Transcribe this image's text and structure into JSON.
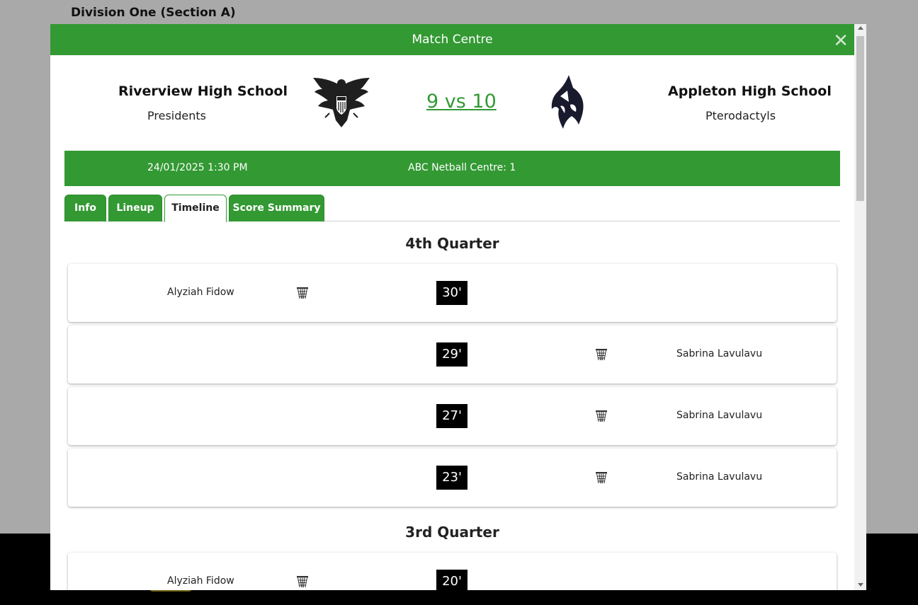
{
  "page": {
    "heading": "Division One (Section A)"
  },
  "modal": {
    "title": "Match Centre",
    "close_label": "✕",
    "home_team": {
      "name": "Riverview High School",
      "nickname": "Presidents",
      "logo": "eagle-icon"
    },
    "away_team": {
      "name": "Appleton High School",
      "nickname": "Pterodactyls",
      "logo": "dragon-icon"
    },
    "score": "9 vs 10",
    "match_info": {
      "datetime": "24/01/2025 1:30 PM",
      "venue": "ABC Netball Centre: 1"
    },
    "tabs": [
      {
        "label": "Info",
        "active": false
      },
      {
        "label": "Lineup",
        "active": false
      },
      {
        "label": "Timeline",
        "active": true
      },
      {
        "label": "Score Summary",
        "active": false
      }
    ],
    "timeline": [
      {
        "quarter": "4th Quarter",
        "events": [
          {
            "minute": "30'",
            "home_player": "Alyziah Fidow",
            "away_player": "",
            "icon": "netball-hoop-icon"
          },
          {
            "minute": "29'",
            "home_player": "",
            "away_player": "Sabrina Lavulavu",
            "icon": "netball-hoop-icon"
          },
          {
            "minute": "27'",
            "home_player": "",
            "away_player": "Sabrina Lavulavu",
            "icon": "netball-hoop-icon"
          },
          {
            "minute": "23'",
            "home_player": "",
            "away_player": "Sabrina Lavulavu",
            "icon": "netball-hoop-icon"
          }
        ]
      },
      {
        "quarter": "3rd Quarter",
        "events": [
          {
            "minute": "20'",
            "home_player": "Alyziah Fidow",
            "away_player": "",
            "icon": "netball-hoop-icon"
          }
        ]
      }
    ]
  },
  "colors": {
    "primary": "#339933",
    "overlay": "#a9a9a9",
    "minute_badge": "#000000"
  }
}
